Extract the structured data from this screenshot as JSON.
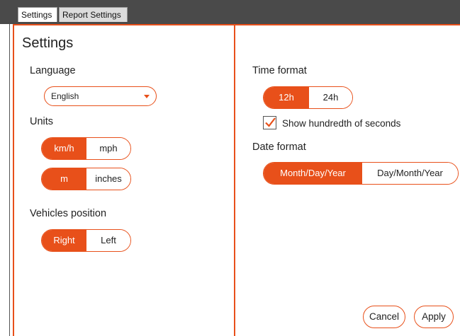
{
  "tabs": [
    {
      "label": "Settings",
      "active": true
    },
    {
      "label": "Report Settings",
      "active": false
    }
  ],
  "left": {
    "title": "Settings",
    "language_label": "Language",
    "language_value": "English",
    "units_label": "Units",
    "speed_units": {
      "options": [
        "km/h",
        "mph"
      ],
      "selected": "km/h"
    },
    "length_units": {
      "options": [
        "m",
        "inches"
      ],
      "selected": "m"
    },
    "vehicles_label": "Vehicles position",
    "vehicles_position": {
      "options": [
        "Right",
        "Left"
      ],
      "selected": "Right"
    }
  },
  "right": {
    "time_label": "Time format",
    "time_format": {
      "options": [
        "12h",
        "24h"
      ],
      "selected": "12h"
    },
    "hundredth_label": "Show hundredth of seconds",
    "hundredth_checked": true,
    "date_label": "Date format",
    "date_format": {
      "options": [
        "Month/Day/Year",
        "Day/Month/Year"
      ],
      "selected": "Month/Day/Year"
    }
  },
  "footer": {
    "cancel_label": "Cancel",
    "apply_label": "Apply"
  },
  "colors": {
    "accent": "#e8501a",
    "topbar": "#4a4a4a"
  }
}
